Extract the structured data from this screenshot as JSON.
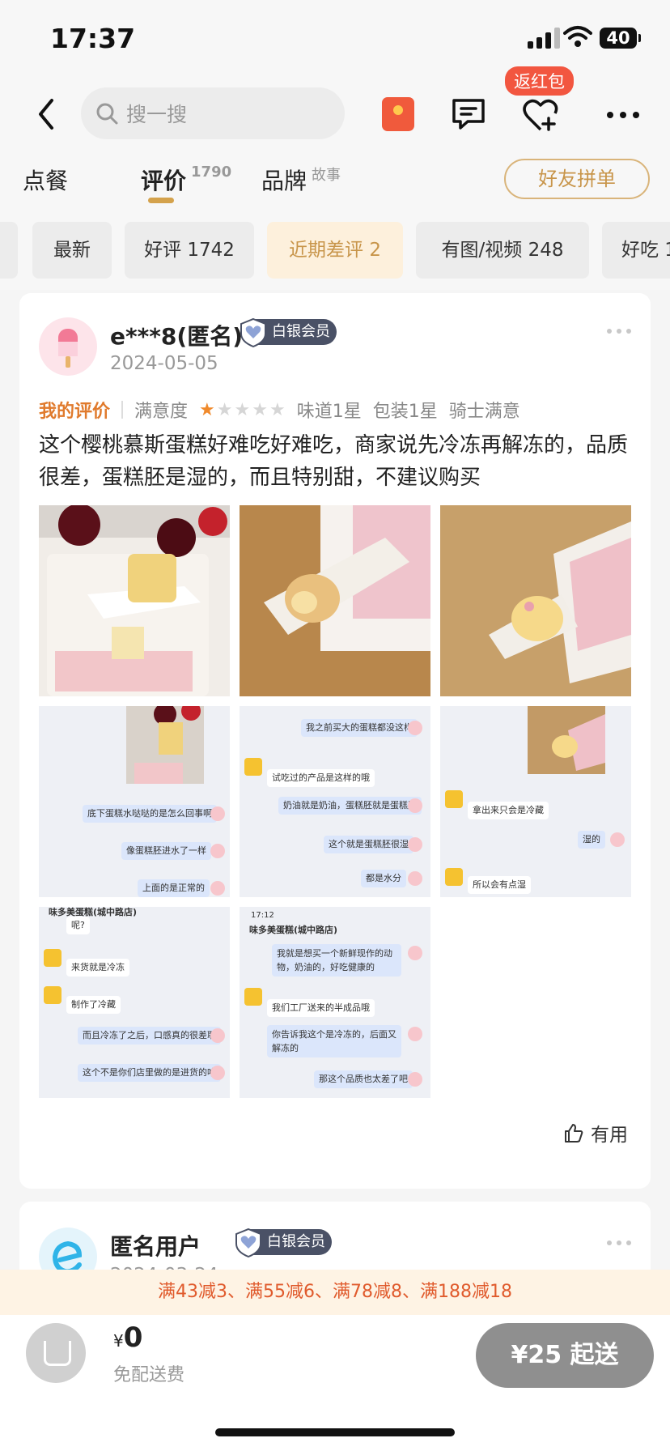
{
  "status": {
    "time": "17:37",
    "battery": "40"
  },
  "nav": {
    "search_placeholder": "搜一搜",
    "fan_badge": "返红包"
  },
  "tabs": [
    {
      "label": "点餐",
      "count": ""
    },
    {
      "label": "评价",
      "count": "1790"
    },
    {
      "label": "品牌",
      "count": "故事"
    }
  ],
  "friend_button": "好友拼单",
  "filters": [
    "最新",
    "好评 1742",
    "近期差评 2",
    "有图/视频 248",
    "好吃 1"
  ],
  "review": {
    "user": "e***8(匿名)",
    "badge": "白银会员",
    "date": "2024-05-05",
    "my_label": "我的评价",
    "satisfaction_label": "满意度",
    "stars": 1,
    "taste": "味道1星",
    "packaging": "包装1星",
    "rider": "骑士满意",
    "text": "这个樱桃慕斯蛋糕好难吃好难吃，商家说先冷冻再解冻的，品质很差，蛋糕胚是湿的，而且特别甜，不建议购买",
    "useful": "有用",
    "chat_texts": {
      "c4a": "底下蛋糕水哒哒的是怎么回事啊",
      "c4b": "像蛋糕胚进水了一样",
      "c4c": "上面的是正常的",
      "c5a": "我之前买大的蛋糕都没这样",
      "c5b": "试吃过的产品是这样的哦",
      "c5c": "奶油就是奶油，蛋糕胚就是蛋糕胚",
      "c5d": "这个就是蛋糕胚很湿",
      "c5e": "都是水分",
      "c6a": "拿出来只会是冷藏",
      "c6b": "湿的",
      "c6c": "所以会有点湿",
      "c7h": "味多美蛋糕(城中路店)",
      "c7a": "呢?",
      "c7b": "来货就是冷冻",
      "c7c": "制作了冷藏",
      "c7d": "而且冷冻了之后，口感真的很差耶",
      "c7e": "这个不是你们店里做的是进货的咯",
      "c8time": "17:12",
      "c8h": "味多美蛋糕(城中路店)",
      "c8a": "我就是想买一个新鲜现作的动物，奶油的，好吃健康的",
      "c8b": "我们工厂送来的半成品哦",
      "c8c": "你告诉我这个是冷冻的，后面又解冻的",
      "c8d": "那这个品质也太差了吧"
    }
  },
  "review2": {
    "user": "匿名用户",
    "badge": "白银会员",
    "date": "2024-03-24"
  },
  "promo": "满43减3、满55减6、满78减8、满188减18",
  "cart": {
    "currency": "¥",
    "amount": "0",
    "delivery": "免配送费",
    "min_order": "¥25 起送"
  }
}
